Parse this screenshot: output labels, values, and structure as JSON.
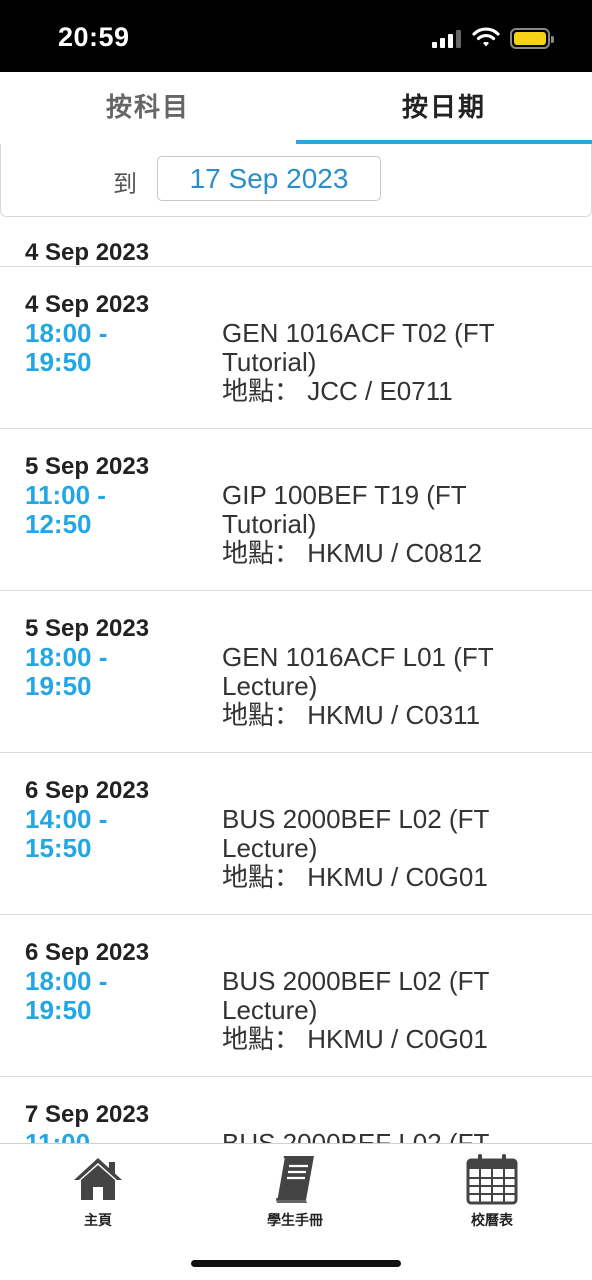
{
  "status": {
    "time": "20:59",
    "battery_color": "#f7d117"
  },
  "tabs": [
    {
      "label": "按科目",
      "active": false
    },
    {
      "label": "按日期",
      "active": true
    }
  ],
  "accent_color": "#2aa6e3",
  "filter": {
    "to_label": "到",
    "date": "17 Sep 2023"
  },
  "group_header": "4 Sep 2023",
  "events": [
    {
      "date": "4 Sep 2023",
      "time": "18:00 - 19:50",
      "title": "GEN 1016ACF T02 (FT Tutorial)",
      "location": "地點： JCC / E0711"
    },
    {
      "date": "5 Sep 2023",
      "time": "11:00 - 12:50",
      "title": "GIP 100BEF T19 (FT Tutorial)",
      "location": "地點： HKMU / C0812"
    },
    {
      "date": "5 Sep 2023",
      "time": "18:00 - 19:50",
      "title": "GEN 1016ACF L01 (FT Lecture)",
      "location": "地點： HKMU / C0311"
    },
    {
      "date": "6 Sep 2023",
      "time": "14:00 - 15:50",
      "title": "BUS 2000BEF L02 (FT Lecture)",
      "location": "地點： HKMU / C0G01"
    },
    {
      "date": "6 Sep 2023",
      "time": "18:00 - 19:50",
      "title": "BUS 2000BEF L02 (FT Lecture)",
      "location": "地點： HKMU / C0G01"
    },
    {
      "date": "7 Sep 2023",
      "time": "11:00 -",
      "title": "BUS 2000BEF L02 (FT",
      "location": ""
    }
  ],
  "nav": [
    {
      "label": "主頁",
      "icon": "home-icon"
    },
    {
      "label": "學生手冊",
      "icon": "handbook-icon"
    },
    {
      "label": "校曆表",
      "icon": "calendar-icon"
    }
  ]
}
